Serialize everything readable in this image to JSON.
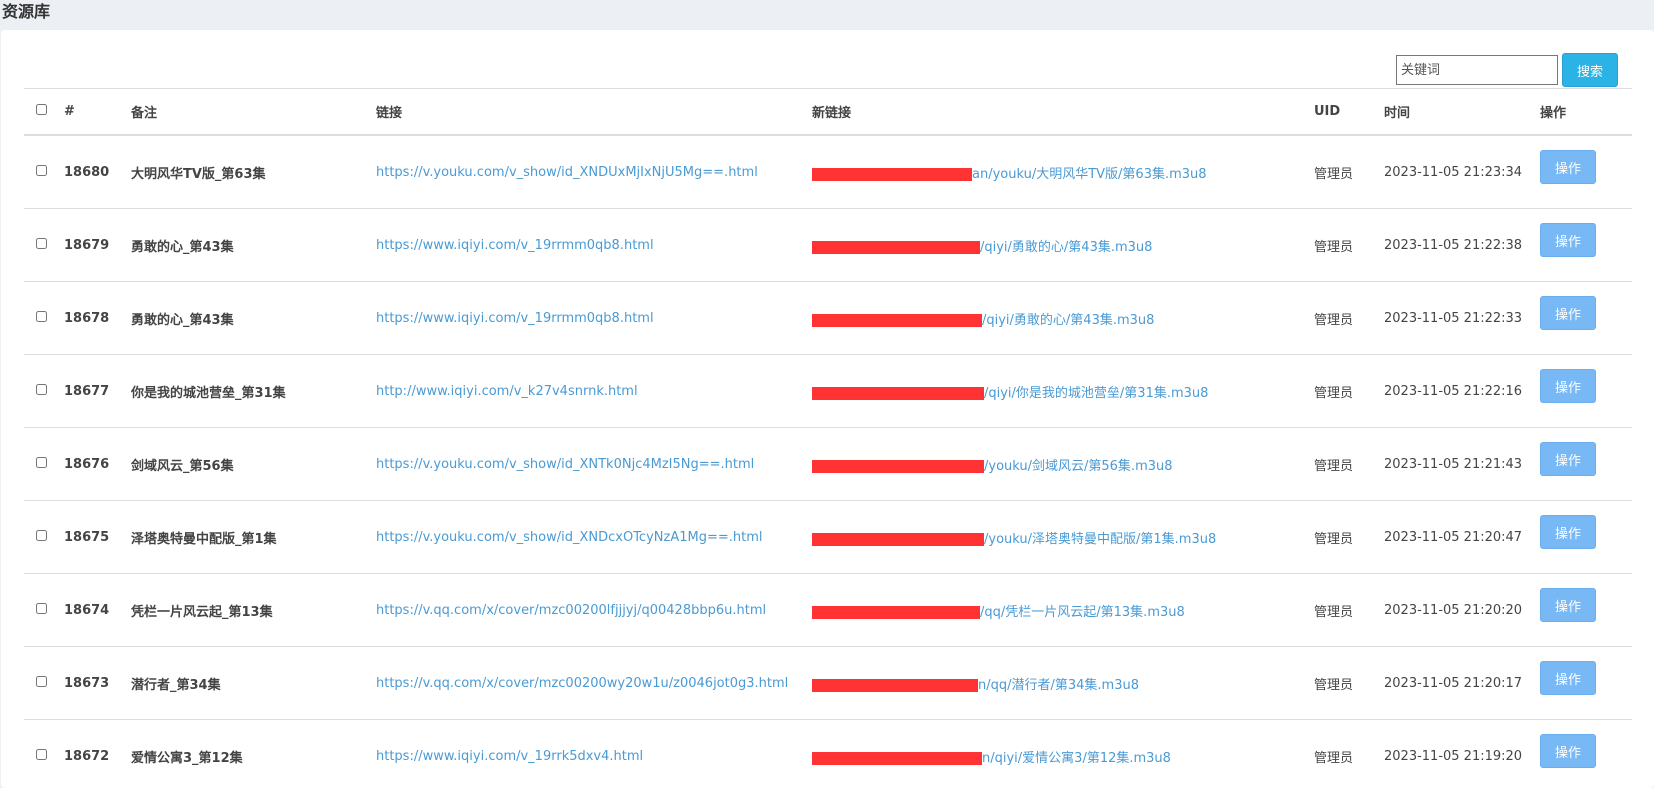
{
  "page": {
    "title": "资源库"
  },
  "search": {
    "placeholder": "关键词",
    "button": "搜索"
  },
  "table": {
    "headers": {
      "id": "#",
      "note": "备注",
      "link": "链接",
      "new_link": "新链接",
      "uid": "UID",
      "time": "时间",
      "action": "操作"
    },
    "rows": [
      {
        "id": "18680",
        "note": "大明风华TV版_第63集",
        "link": "https://v.youku.com/v_show/id_XNDUxMjIxNjU5Mg==.html",
        "new_link_visible": "an/youku/大明风华TV版/第63集.m3u8",
        "uid": "管理员",
        "time": "2023-11-05 21:23:34",
        "action": "操作"
      },
      {
        "id": "18679",
        "note": "勇敢的心_第43集",
        "link": "https://www.iqiyi.com/v_19rrmm0qb8.html",
        "new_link_visible": "/qiyi/勇敢的心/第43集.m3u8",
        "uid": "管理员",
        "time": "2023-11-05 21:22:38",
        "action": "操作"
      },
      {
        "id": "18678",
        "note": "勇敢的心_第43集",
        "link": "https://www.iqiyi.com/v_19rrmm0qb8.html",
        "new_link_visible": "/qiyi/勇敢的心/第43集.m3u8",
        "uid": "管理员",
        "time": "2023-11-05 21:22:33",
        "action": "操作"
      },
      {
        "id": "18677",
        "note": "你是我的城池营垒_第31集",
        "link": "http://www.iqiyi.com/v_k27v4snrnk.html",
        "new_link_visible": "/qiyi/你是我的城池营垒/第31集.m3u8",
        "uid": "管理员",
        "time": "2023-11-05 21:22:16",
        "action": "操作"
      },
      {
        "id": "18676",
        "note": "剑域风云_第56集",
        "link": "https://v.youku.com/v_show/id_XNTk0Njc4MzI5Ng==.html",
        "new_link_visible": "/youku/剑域风云/第56集.m3u8",
        "uid": "管理员",
        "time": "2023-11-05 21:21:43",
        "action": "操作"
      },
      {
        "id": "18675",
        "note": "泽塔奥特曼中配版_第1集",
        "link": "https://v.youku.com/v_show/id_XNDcxOTcyNzA1Mg==.html",
        "new_link_visible": "/youku/泽塔奥特曼中配版/第1集.m3u8",
        "uid": "管理员",
        "time": "2023-11-05 21:20:47",
        "action": "操作"
      },
      {
        "id": "18674",
        "note": "凭栏一片风云起_第13集",
        "link": "https://v.qq.com/x/cover/mzc00200lfjjjyj/q00428bbp6u.html",
        "new_link_visible": "/qq/凭栏一片风云起/第13集.m3u8",
        "uid": "管理员",
        "time": "2023-11-05 21:20:20",
        "action": "操作"
      },
      {
        "id": "18673",
        "note": "潜行者_第34集",
        "link": "https://v.qq.com/x/cover/mzc00200wy20w1u/z0046jot0g3.html",
        "new_link_visible": "n/qq/潜行者/第34集.m3u8",
        "uid": "管理员",
        "time": "2023-11-05 21:20:17",
        "action": "操作"
      },
      {
        "id": "18672",
        "note": "爱情公寓3_第12集",
        "link": "https://www.iqiyi.com/v_19rrk5dxv4.html",
        "new_link_visible": "n/qiyi/爱情公寓3/第12集.m3u8",
        "uid": "管理员",
        "time": "2023-11-05 21:19:20",
        "action": "操作"
      }
    ]
  }
}
